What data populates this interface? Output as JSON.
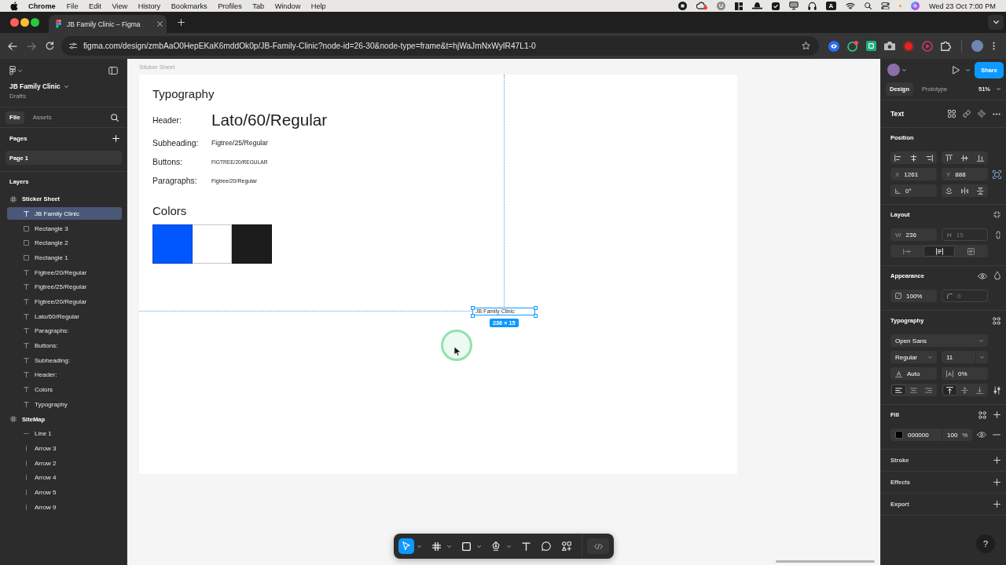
{
  "menubar": {
    "app": "Chrome",
    "menus": [
      "File",
      "Edit",
      "View",
      "History",
      "Bookmarks",
      "Profiles",
      "Tab",
      "Window",
      "Help"
    ],
    "input_source": "A",
    "clock": "Wed 23 Oct 7:00 PM"
  },
  "browser": {
    "tab_title": "JB Family Clinic – Figma",
    "url": "figma.com/design/zmbAaO0HepEKaK6mddOk0p/JB-Family-Clinic?node-id=26-30&node-type=frame&t=hjWaJmNxWyIR47L1-0"
  },
  "file": {
    "name": "JB Family Clinic",
    "location": "Drafts"
  },
  "panel_tabs": [
    {
      "label": "File",
      "selected": true
    },
    {
      "label": "Assets",
      "selected": false
    }
  ],
  "pages": {
    "title": "Pages",
    "items": [
      {
        "label": "Page 1",
        "selected": true
      }
    ]
  },
  "layers": {
    "title": "Layers",
    "items": [
      {
        "name": "Sticker Sheet",
        "kind": "frame",
        "selected": false,
        "children": [
          {
            "name": "JB Family Clinic",
            "kind": "text",
            "selected": true
          },
          {
            "name": "Rectangle 3",
            "kind": "rectangle",
            "selected": false
          },
          {
            "name": "Rectangle 2",
            "kind": "rectangle",
            "selected": false
          },
          {
            "name": "Rectangle 1",
            "kind": "rectangle",
            "selected": false
          },
          {
            "name": "Figtree/20/Regular",
            "kind": "text",
            "selected": false
          },
          {
            "name": "Figtree/25/Regular",
            "kind": "text",
            "selected": false
          },
          {
            "name": "Figtree/20/Regular",
            "kind": "text",
            "selected": false
          },
          {
            "name": "Lato/60/Regular",
            "kind": "text",
            "selected": false
          },
          {
            "name": "Paragraphs:",
            "kind": "text",
            "selected": false
          },
          {
            "name": "Buttons:",
            "kind": "text",
            "selected": false
          },
          {
            "name": "Subheading:",
            "kind": "text",
            "selected": false
          },
          {
            "name": "Header:",
            "kind": "text",
            "selected": false
          },
          {
            "name": "Colors",
            "kind": "text",
            "selected": false
          },
          {
            "name": "Typography",
            "kind": "text",
            "selected": false
          }
        ]
      },
      {
        "name": "SiteMap",
        "kind": "frame",
        "selected": false,
        "children": [
          {
            "name": "Line 1",
            "kind": "line",
            "selected": false
          },
          {
            "name": "Arrow 3",
            "kind": "arrow",
            "selected": false
          },
          {
            "name": "Arrow 2",
            "kind": "arrow",
            "selected": false
          },
          {
            "name": "Arrow 4",
            "kind": "arrow",
            "selected": false
          },
          {
            "name": "Arrow 5",
            "kind": "arrow",
            "selected": false
          },
          {
            "name": "Arrow 9",
            "kind": "arrow",
            "selected": false
          }
        ]
      }
    ]
  },
  "canvas": {
    "frame_label": "Sticker Sheet",
    "typography_title": "Typography",
    "styles": [
      {
        "kind": "header",
        "label": "Header:",
        "sample": "Lato/60/Regular"
      },
      {
        "kind": "subheading",
        "label": "Subheading:",
        "sample": "Figtree/25/Regular"
      },
      {
        "kind": "buttons",
        "label": "Buttons:",
        "sample": "FIGTREE/20/REGULAR"
      },
      {
        "kind": "paragraphs",
        "label": "Paragraphs:",
        "sample": "Figtree/20/Regular"
      }
    ],
    "colors_title": "Colors",
    "swatches": [
      {
        "color": "#0057ff"
      },
      {
        "color": "#ffffff"
      },
      {
        "color": "#1c1c1c"
      }
    ],
    "selection": {
      "text": "JB Family Clinic",
      "size": "236 × 15"
    }
  },
  "toolbar": {
    "tools": [
      {
        "kind": "move",
        "selected": true,
        "menu": true
      },
      {
        "kind": "frame",
        "selected": false,
        "menu": true
      },
      {
        "kind": "rectangle",
        "selected": false,
        "menu": true
      },
      {
        "kind": "pen",
        "selected": false,
        "menu": true
      },
      {
        "kind": "text",
        "selected": false,
        "menu": false
      },
      {
        "kind": "comment",
        "selected": false,
        "menu": false
      },
      {
        "kind": "actions",
        "selected": false,
        "menu": false
      }
    ],
    "dev_mode": false
  },
  "right_panel": {
    "share": "Share",
    "tabs": [
      {
        "label": "Design",
        "selected": true
      },
      {
        "label": "Prototype",
        "selected": false
      }
    ],
    "zoom": "51%",
    "selection_type": "Text",
    "position": {
      "title": "Position",
      "fields": [
        {
          "label": "X",
          "value": "1261"
        },
        {
          "label": "Y",
          "value": "888"
        }
      ],
      "rotation": "0°"
    },
    "layout": {
      "title": "Layout",
      "fields": [
        {
          "label": "W",
          "value": "236",
          "disabled": false
        },
        {
          "label": "H",
          "value": "15",
          "disabled": true
        }
      ],
      "resizing": [
        {
          "kind": "auto_width",
          "selected": false
        },
        {
          "kind": "auto_height",
          "selected": true
        },
        {
          "kind": "fixed",
          "selected": false
        }
      ]
    },
    "appearance": {
      "title": "Appearance",
      "opacity": "100%",
      "radius": {
        "value": "0",
        "disabled": true
      }
    },
    "typography": {
      "title": "Typography",
      "font": "Open Sans",
      "weight": "Regular",
      "size": "11",
      "line_height": "Auto",
      "letter_spacing": "0%",
      "align_horizontal": [
        {
          "kind": "left",
          "selected": true
        },
        {
          "kind": "center",
          "selected": false
        },
        {
          "kind": "right",
          "selected": false
        }
      ],
      "align_vertical": [
        {
          "kind": "top",
          "selected": true
        },
        {
          "kind": "middle",
          "selected": false
        },
        {
          "kind": "bottom",
          "selected": false
        }
      ]
    },
    "fill": {
      "title": "Fill",
      "items": [
        {
          "color": "#000000",
          "hex": "000000",
          "opacity": "100",
          "unit": "%"
        }
      ]
    },
    "empty_sections": [
      {
        "title": "Stroke"
      },
      {
        "title": "Effects"
      },
      {
        "title": "Export"
      }
    ],
    "help": "?"
  }
}
